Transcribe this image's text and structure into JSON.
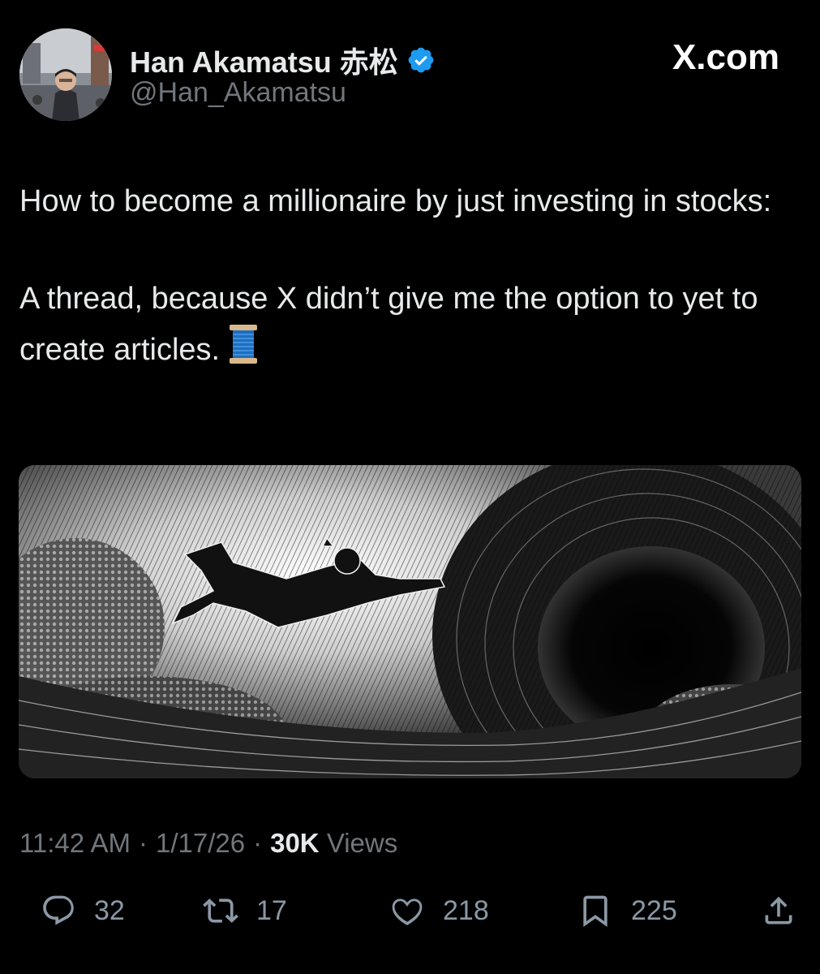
{
  "author": {
    "name": "Han Akamatsu 赤松",
    "handle": "@Han_Akamatsu",
    "verified": true,
    "avatar_icon": "avatar-photo"
  },
  "brand": {
    "label": "X.com"
  },
  "post": {
    "paragraph1": "How to become a millionaire by just investing in stocks:",
    "paragraph2": "A thread, because X didn’t give me the option to yet to create articles.",
    "emoji_icon": "spool-of-thread-icon"
  },
  "media": {
    "icon": "figure-falling-into-vortex-illustration"
  },
  "meta": {
    "time": "11:42 AM",
    "date": "1/17/26",
    "views_count": "30K",
    "views_label": "Views",
    "separator": "·"
  },
  "actions": {
    "replies": "32",
    "reposts": "17",
    "likes": "218",
    "bookmarks": "225"
  },
  "colors": {
    "accent": "#1d9bf0",
    "muted": "#71767b",
    "text": "#e7e9ea",
    "background": "#000000"
  }
}
